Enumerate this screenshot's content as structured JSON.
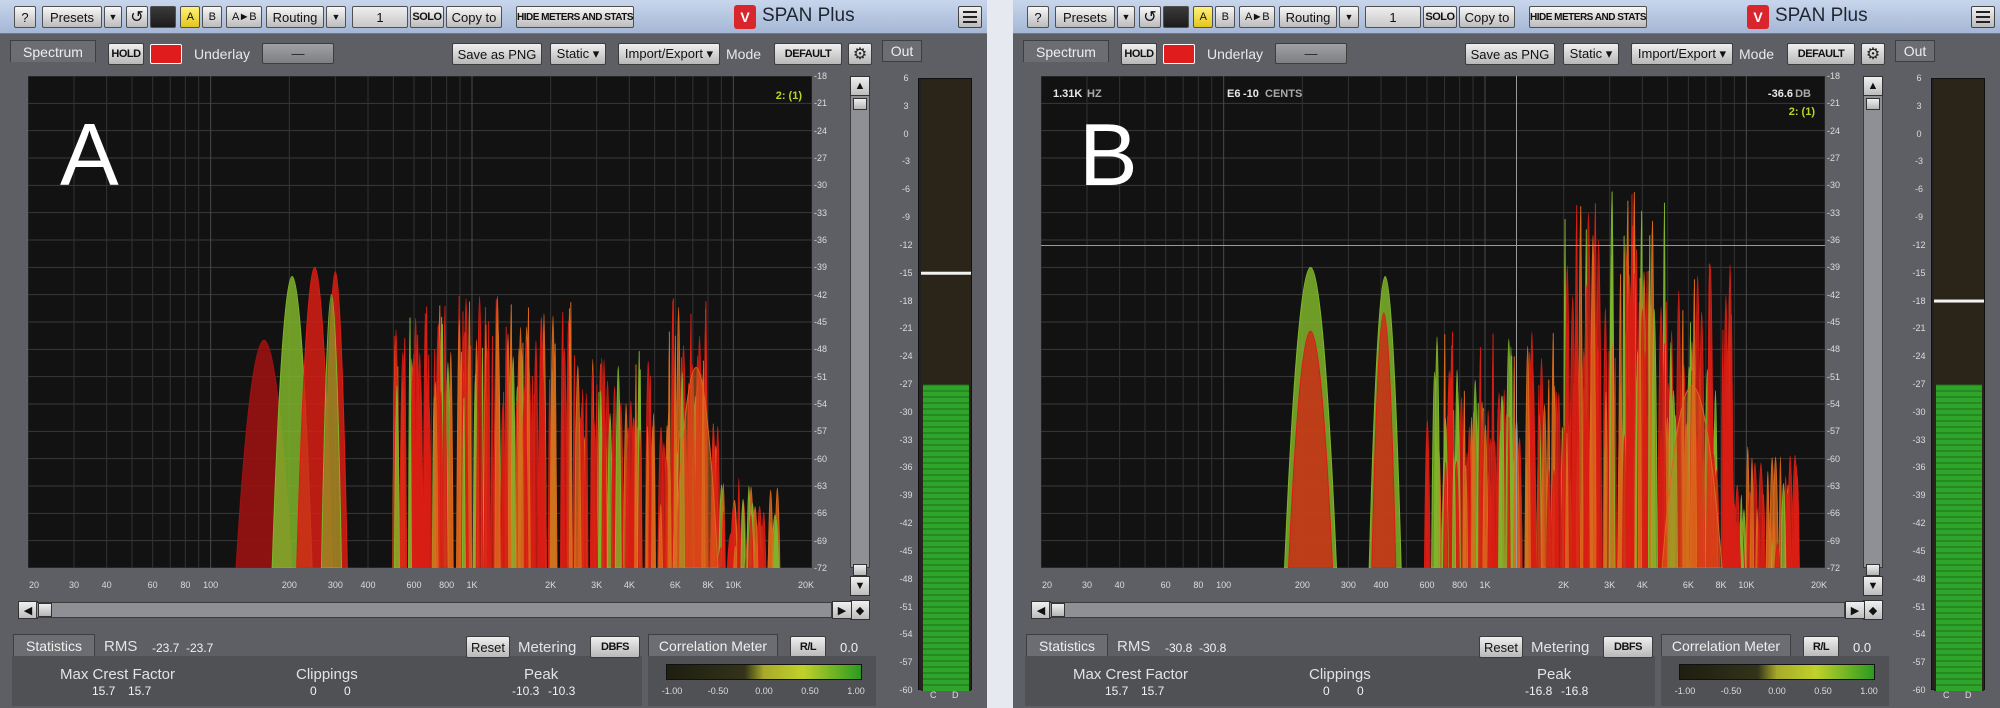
{
  "toolbar": {
    "help": "?",
    "presets": "Presets",
    "presets_menu": "▼",
    "undo": "↺",
    "slot_a": "A",
    "slot_b": "B",
    "copy_ab": "A►B",
    "routing": "Routing",
    "routing_menu": "▼",
    "channel": "1",
    "solo": "SOLO",
    "copy_to": "Copy to",
    "hide": "HIDE METERS AND STATS",
    "logo": "V",
    "product": "SPAN Plus"
  },
  "spectrum_bar": {
    "tab": "Spectrum",
    "hold": "HOLD",
    "underlay": "Underlay",
    "underlay_value": "—",
    "save_png": "Save as PNG",
    "static": "Static ▾",
    "import_export": "Import/Export ▾",
    "mode": "Mode",
    "mode_value": "DEFAULT",
    "gear": "⚙",
    "out": "Out"
  },
  "spectrum_axis": {
    "y_labels": [
      "-18",
      "-21",
      "-24",
      "-27",
      "-30",
      "-33",
      "-36",
      "-39",
      "-42",
      "-45",
      "-48",
      "-51",
      "-54",
      "-57",
      "-60",
      "-63",
      "-66",
      "-69",
      "-72"
    ],
    "x_labels": [
      "20",
      "30",
      "40",
      "60",
      "80",
      "100",
      "200",
      "300",
      "400",
      "600",
      "800",
      "1K",
      "2K",
      "3K",
      "4K",
      "6K",
      "8K",
      "10K",
      "20K"
    ],
    "x_freqs": [
      20,
      30,
      40,
      60,
      80,
      100,
      200,
      300,
      400,
      600,
      800,
      1000,
      2000,
      3000,
      4000,
      6000,
      8000,
      10000,
      20000
    ]
  },
  "meter_scale": [
    "6",
    "3",
    "0",
    "-3",
    "-6",
    "-9",
    "-12",
    "-15",
    "-18",
    "-21",
    "-24",
    "-27",
    "-30",
    "-33",
    "-36",
    "-39",
    "-42",
    "-45",
    "-48",
    "-51",
    "-54",
    "-57",
    "-60"
  ],
  "meter_channels": [
    "C",
    "D"
  ],
  "correlation": {
    "tab": "Correlation Meter",
    "mode": "R/L",
    "value": "0.0",
    "labels": [
      "-1.00",
      "-0.50",
      "0.00",
      "0.50",
      "1.00"
    ]
  },
  "statistics": {
    "tab": "Statistics",
    "rms_label": "RMS",
    "reset": "Reset",
    "metering": "Metering",
    "metering_value": "DBFS",
    "crest_label": "Max Crest Factor",
    "clip_label": "Clippings",
    "peak_label": "Peak"
  },
  "panels": [
    {
      "label": "A",
      "rms": [
        "-23.7",
        "-23.7"
      ],
      "crest": [
        "15.7",
        "15.7"
      ],
      "clippings": [
        "0",
        "0"
      ],
      "peak": [
        "-10.3",
        "-10.3"
      ],
      "channel_tag": "2: (1)",
      "meter_level_db": -27,
      "meter_peak_db": -15,
      "cursor_readout": null
    },
    {
      "label": "B",
      "rms": [
        "-30.8",
        "-30.8"
      ],
      "crest": [
        "15.7",
        "15.7"
      ],
      "clippings": [
        "0",
        "0"
      ],
      "peak": [
        "-16.8",
        "-16.8"
      ],
      "channel_tag": "2: (1)",
      "meter_level_db": -27,
      "meter_peak_db": -18,
      "cursor_readout": {
        "freq": "1.31K",
        "freq_unit": "HZ",
        "note": "E6",
        "cents": "-10",
        "cents_unit": "CENTS",
        "level": "-36.6",
        "level_unit": "DB"
      }
    }
  ],
  "colors": {
    "red": "#d81e14",
    "green": "#7fb52c",
    "orange": "#d96a1c",
    "meter_green": "#2ea52a"
  }
}
